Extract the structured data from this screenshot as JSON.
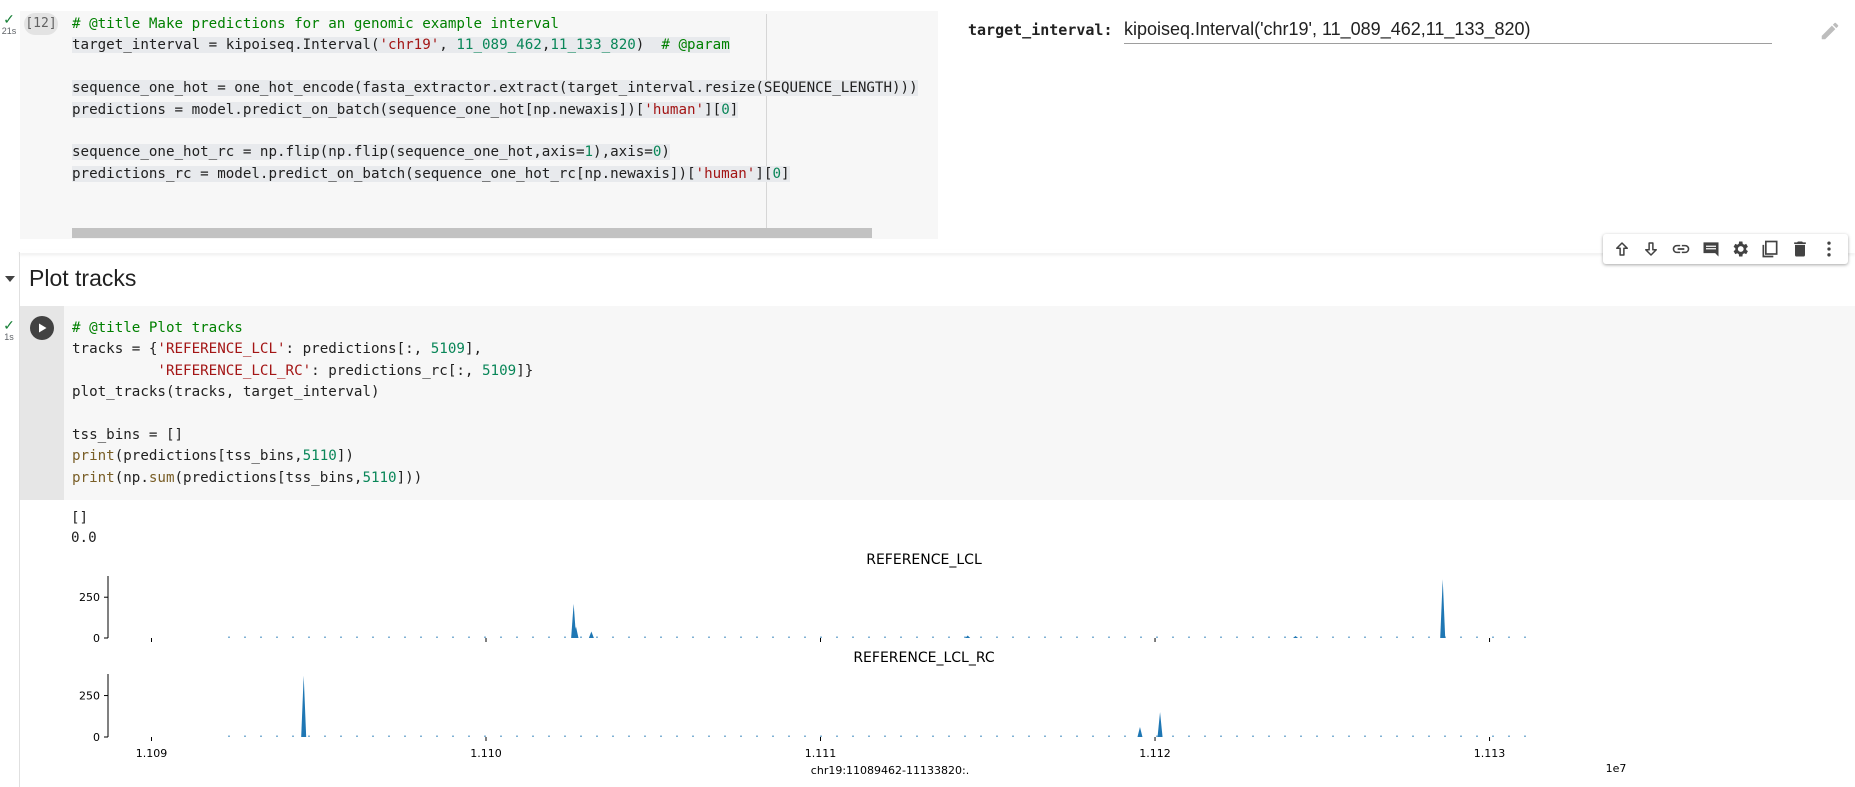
{
  "cell1": {
    "status_time": "21s",
    "execution_count": "[12]",
    "lines": [
      [
        {
          "t": "# @title Make predictions for an genomic example interval",
          "c": "c-com2"
        }
      ],
      [
        {
          "t": "target_interval = kipoiseq.Interval(",
          "c": ""
        },
        {
          "t": "'chr19'",
          "c": "c-str"
        },
        {
          "t": ", ",
          "c": ""
        },
        {
          "t": "11_089_462",
          "c": "c-num"
        },
        {
          "t": ",",
          "c": ""
        },
        {
          "t": "11_133_820",
          "c": "c-num"
        },
        {
          "t": ")  ",
          "c": ""
        },
        {
          "t": "# @param",
          "c": "c-com2"
        }
      ],
      [
        {
          "t": "",
          "c": ""
        }
      ],
      [
        {
          "t": "sequence_one_hot = one_hot_encode(fasta_extractor.extract(target_interval.resize(SEQUENCE_LENGTH)))",
          "c": ""
        }
      ],
      [
        {
          "t": "predictions = model.predict_on_batch(sequence_one_hot[np.newaxis])[",
          "c": ""
        },
        {
          "t": "'human'",
          "c": "c-str"
        },
        {
          "t": "][",
          "c": ""
        },
        {
          "t": "0",
          "c": "c-num"
        },
        {
          "t": "]",
          "c": ""
        }
      ],
      [
        {
          "t": "",
          "c": ""
        }
      ],
      [
        {
          "t": "sequence_one_hot_rc = np.flip(np.flip(sequence_one_hot,axis=",
          "c": ""
        },
        {
          "t": "1",
          "c": "c-num"
        },
        {
          "t": "),axis=",
          "c": ""
        },
        {
          "t": "0",
          "c": "c-num"
        },
        {
          "t": ")",
          "c": ""
        }
      ],
      [
        {
          "t": "predictions_rc = model.predict_on_batch(sequence_one_hot_rc[np.newaxis])[",
          "c": ""
        },
        {
          "t": "'human'",
          "c": "c-str"
        },
        {
          "t": "][",
          "c": ""
        },
        {
          "t": "0",
          "c": "c-num"
        },
        {
          "t": "]",
          "c": ""
        }
      ],
      [
        {
          "t": "",
          "c": ""
        }
      ]
    ]
  },
  "form": {
    "label": "target_interval:",
    "value": "kipoiseq.Interval('chr19', 11_089_462,11_133_820)",
    "edit_icon": "pencil-icon"
  },
  "toolbar": {
    "icons": [
      "arrow-up-icon",
      "arrow-down-icon",
      "link-icon",
      "comment-icon",
      "gear-icon",
      "mirror-cell-icon",
      "trash-icon",
      "more-vert-icon"
    ]
  },
  "section": {
    "title": "Plot tracks",
    "collapse_icon": "caret-down-icon"
  },
  "cell2": {
    "status_time": "1s",
    "lines": [
      [
        {
          "t": "# @title Plot tracks",
          "c": "c-com2"
        }
      ],
      [
        {
          "t": "tracks = {",
          "c": ""
        },
        {
          "t": "'REFERENCE_LCL'",
          "c": "c-str"
        },
        {
          "t": ": predictions[:, ",
          "c": ""
        },
        {
          "t": "5109",
          "c": "c-num"
        },
        {
          "t": "],",
          "c": ""
        }
      ],
      [
        {
          "t": "          ",
          "c": ""
        },
        {
          "t": "'REFERENCE_LCL_RC'",
          "c": "c-str"
        },
        {
          "t": ": predictions_rc[:, ",
          "c": ""
        },
        {
          "t": "5109",
          "c": "c-num"
        },
        {
          "t": "]}",
          "c": ""
        }
      ],
      [
        {
          "t": "plot_tracks(tracks, target_interval)",
          "c": ""
        }
      ],
      [
        {
          "t": "",
          "c": ""
        }
      ],
      [
        {
          "t": "tss_bins = []",
          "c": ""
        }
      ],
      [
        {
          "t": "print",
          "c": "c-fn"
        },
        {
          "t": "(predictions[tss_bins,",
          "c": ""
        },
        {
          "t": "5110",
          "c": "c-num"
        },
        {
          "t": "])",
          "c": ""
        }
      ],
      [
        {
          "t": "print",
          "c": "c-fn"
        },
        {
          "t": "(np.",
          "c": ""
        },
        {
          "t": "sum",
          "c": "c-fn"
        },
        {
          "t": "(predictions[tss_bins,",
          "c": ""
        },
        {
          "t": "5110",
          "c": "c-num"
        },
        {
          "t": "]))",
          "c": ""
        }
      ]
    ]
  },
  "output": {
    "lines": [
      "[]",
      "0.0"
    ]
  },
  "chart_data": {
    "type": "area",
    "xlabel": "chr19:11089462-11133820:.",
    "x_offset_label": "1e7",
    "xlim": [
      11088700,
      11133900
    ],
    "x_ticks": [
      11090000,
      11100000,
      11110000,
      11120000,
      11130000
    ],
    "x_tick_labels": [
      "1.109",
      "1.110",
      "1.111",
      "1.112",
      "1.113"
    ],
    "series_color": "#1f77b4",
    "panels": [
      {
        "title": "REFERENCE_LCL",
        "ylim": [
          0,
          380
        ],
        "y_ticks": [
          0,
          250
        ],
        "peaks": [
          {
            "x": 11102620,
            "y": 210
          },
          {
            "x": 11102690,
            "y": 70
          },
          {
            "x": 11103150,
            "y": 40
          },
          {
            "x": 11114400,
            "y": 15
          },
          {
            "x": 11124200,
            "y": 12
          },
          {
            "x": 11128600,
            "y": 360
          }
        ]
      },
      {
        "title": "REFERENCE_LCL_RC",
        "ylim": [
          0,
          380
        ],
        "y_ticks": [
          0,
          250
        ],
        "peaks": [
          {
            "x": 11094550,
            "y": 370
          },
          {
            "x": 11119550,
            "y": 60
          },
          {
            "x": 11120150,
            "y": 150
          }
        ]
      }
    ]
  }
}
